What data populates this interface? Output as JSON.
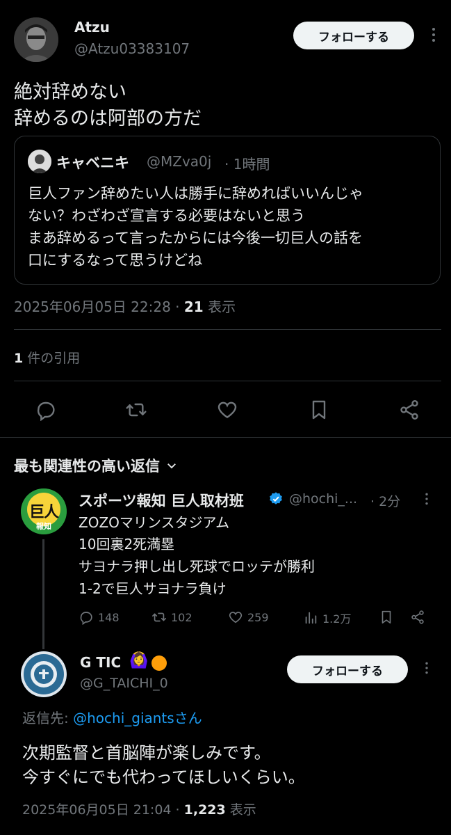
{
  "tweet": {
    "display_name": "Atzu",
    "handle": "@Atzu03383107",
    "follow_label": "フォローする",
    "text_line1": "絶対辞めない",
    "text_line2": "辞めるのは阿部の方だ",
    "quote": {
      "display_name": "キャベニキ",
      "handle": "@MZva0j",
      "time": "· 1時間",
      "line1": "巨人ファン辞めたい人は勝手に辞めればいいんじゃ",
      "line2": "ない？わざわざ宣言する必要はないと思う",
      "line3": "まあ辞めるって言ったからには今後一切巨人の話を",
      "line4": "口にするなって思うけどね"
    },
    "timestamp": "2025年06月05日 22:28 · ",
    "views_count": "21",
    "views_label": " 表示",
    "quotes_count": "1",
    "quotes_label": " 件の引用"
  },
  "replies_header": "最も関連性の高い返信",
  "reply1": {
    "avatar_text": "巨人",
    "avatar_subtext": "報知",
    "display_name": "スポーツ報知 巨人取材班",
    "handle": "@hochi_...",
    "time": "· 2分",
    "line1": "ZOZOマリンスタジアム",
    "line2": "10回裏2死満塁",
    "line3": "サヨナラ押し出し死球でロッテが勝利",
    "line4": "1-2で巨人サヨナラ負け",
    "replies": "148",
    "retweets": "102",
    "likes": "259",
    "views": "1.2万"
  },
  "reply2": {
    "display_name": "G TIC",
    "emoji": "🙆‍♀️",
    "handle": "@G_TAICHI_0",
    "follow_label": "フォローする",
    "reply_to_prefix": "返信先: ",
    "reply_to_handle": "@hochi_giants",
    "reply_to_suffix": "さん",
    "line1": "次期監督と首脳陣が楽しみです。",
    "line2": "今すぐにでも代わってほしいくらい。",
    "timestamp": "2025年06月05日 21:04 · ",
    "views_count": "1,223",
    "views_label": " 表示"
  },
  "colors": {
    "accent": "#1d9bf0",
    "verified": "#1d9bf0",
    "orange": "#ff9f0a"
  }
}
